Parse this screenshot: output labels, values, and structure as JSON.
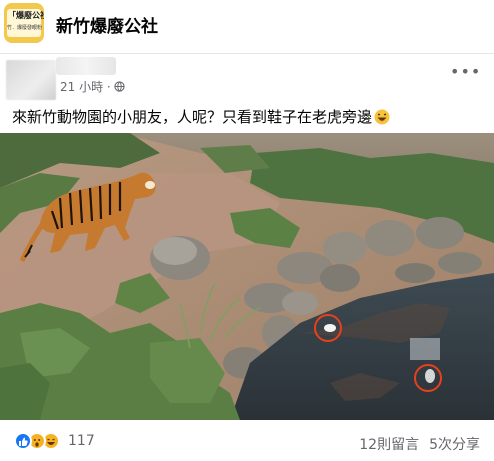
{
  "group": {
    "name": "新竹爆廢公社",
    "logo_text_1": "「爆廢公社",
    "logo_text_2": "竹．爆廢發眼粉"
  },
  "post": {
    "time": "21 小時 ·",
    "text": "來新竹動物園的小朋友，人呢？只看到鞋子在老虎旁邊",
    "more": "•••"
  },
  "footer": {
    "reaction_count": "117",
    "comments": "12則留言",
    "shares": "5次分享"
  },
  "colors": {
    "like": "#1877f2",
    "haha": "#f7b125",
    "highlight_circle": "#e8401c"
  },
  "icons": [
    "globe-icon",
    "laugh-emoji-icon",
    "more-options-icon",
    "like-reaction-icon",
    "wow-reaction-icon",
    "haha-reaction-icon"
  ]
}
